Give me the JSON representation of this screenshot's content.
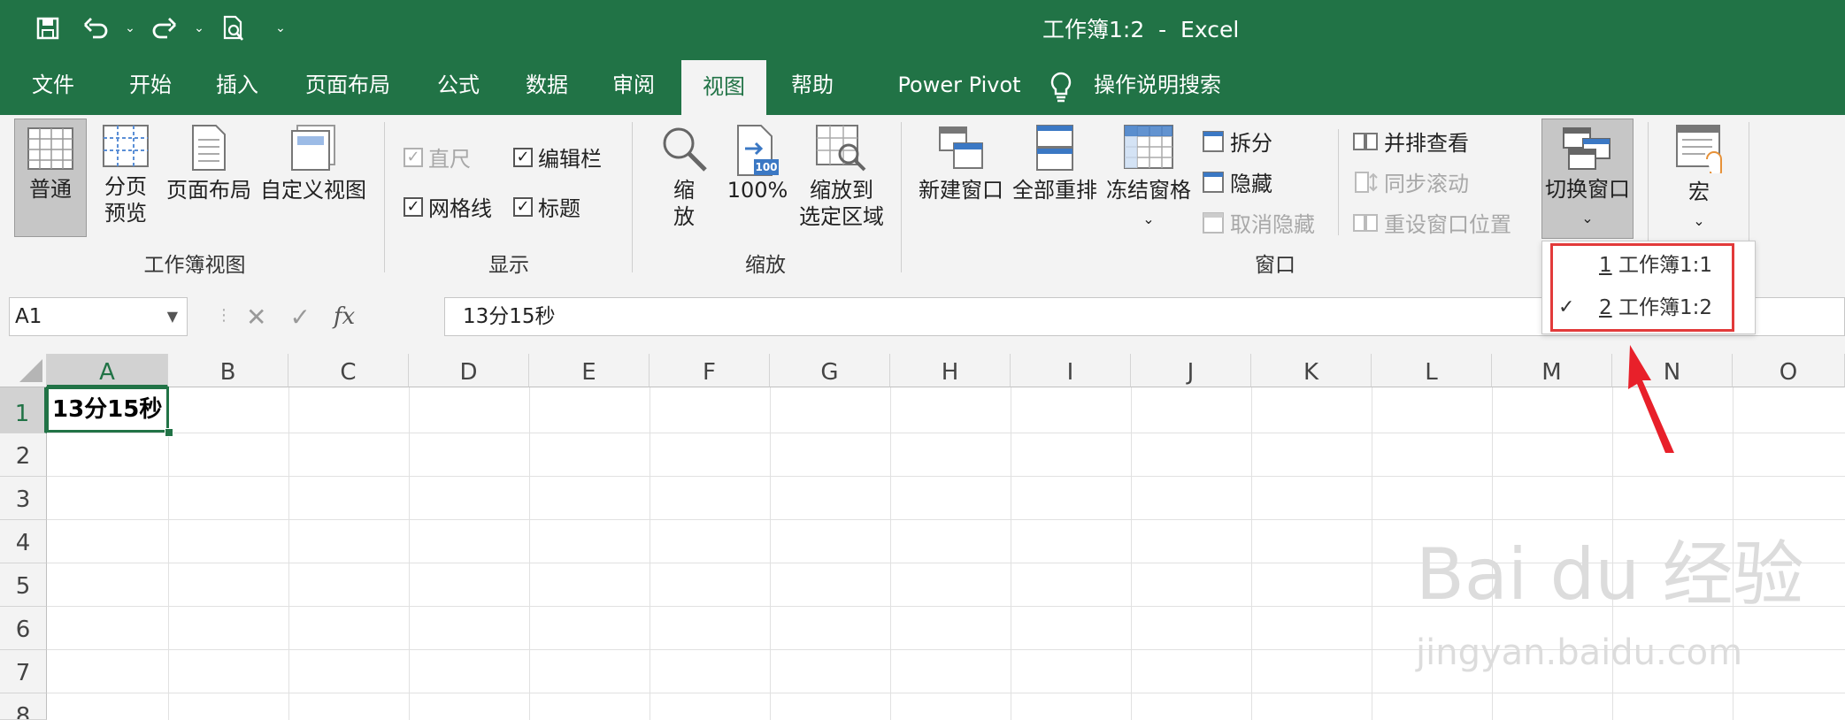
{
  "title": "工作簿1:2  -  Excel",
  "tabs": [
    "文件",
    "开始",
    "插入",
    "页面布局",
    "公式",
    "数据",
    "审阅",
    "视图",
    "帮助",
    "Power Pivot",
    "操作说明搜索"
  ],
  "active_tab": "视图",
  "ribbon": {
    "workbook_views": {
      "label": "工作簿视图",
      "normal": "普通",
      "page_break_l1": "分页",
      "page_break_l2": "预览",
      "page_layout": "页面布局",
      "custom_views": "自定义视图"
    },
    "show": {
      "label": "显示",
      "ruler": "直尺",
      "formula_bar": "编辑栏",
      "gridlines": "网格线",
      "headings": "标题"
    },
    "zoom": {
      "label": "缩放",
      "zoom_l1": "缩",
      "zoom_l2": "放",
      "hundred": "100%",
      "zoom_sel_l1": "缩放到",
      "zoom_sel_l2": "选定区域",
      "badge": "100"
    },
    "window": {
      "label": "窗口",
      "new_window": "新建窗口",
      "arrange_all": "全部重排",
      "freeze_panes": "冻结窗格",
      "split": "拆分",
      "hide": "隐藏",
      "unhide": "取消隐藏",
      "side_by_side": "并排查看",
      "sync_scroll": "同步滚动",
      "reset_position": "重设窗口位置",
      "switch_windows": "切换窗口"
    },
    "macros": {
      "label": "宏"
    }
  },
  "formula_bar": {
    "name_box": "A1",
    "fx": "fx",
    "value": "13分15秒"
  },
  "columns": [
    "A",
    "B",
    "C",
    "D",
    "E",
    "F",
    "G",
    "H",
    "I",
    "J",
    "K",
    "L",
    "M",
    "N",
    "O"
  ],
  "rows": [
    "1",
    "2",
    "3",
    "4",
    "5",
    "6",
    "7",
    "8"
  ],
  "cells": {
    "A1": "13分15秒"
  },
  "switch_menu": [
    {
      "num": "1",
      "text": " 工作簿1:1",
      "checked": false
    },
    {
      "num": "2",
      "text": " 工作簿1:2",
      "checked": true
    }
  ],
  "check_glyph": "✓",
  "watermark": {
    "line1": "Bai du 经验",
    "line2": "jingyan.baidu.com"
  },
  "colors": {
    "accent": "#217346",
    "highlight": "#e23a3a",
    "ribbon_bg": "#f3f3f3"
  }
}
